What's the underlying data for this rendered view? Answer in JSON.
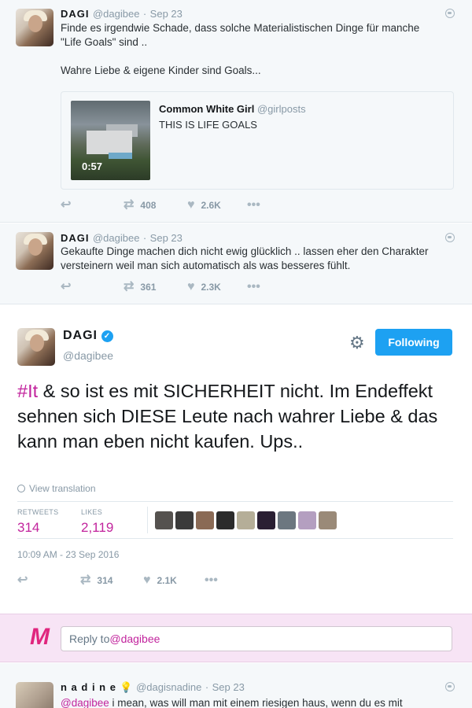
{
  "tweets_above": [
    {
      "name": "DAGI",
      "handle": "@dagibee",
      "date": "Sep 23",
      "text_lines": [
        "Finde es irgendwie Schade, dass solche Materialistischen Dinge für manche",
        "\"Life Goals\" sind ..",
        "",
        "Wahre Liebe & eigene Kinder sind Goals..."
      ],
      "quoted": {
        "name": "Common White Girl",
        "handle": "@girlposts",
        "text": "THIS IS LIFE GOALS",
        "video_duration": "0:57"
      },
      "retweets": "408",
      "likes": "2.6K"
    },
    {
      "name": "DAGI",
      "handle": "@dagibee",
      "date": "Sep 23",
      "text_lines": [
        "Gekaufte Dinge machen dich nicht ewig glücklich .. lassen eher den Charakter",
        "versteinern weil man sich automatisch als was besseres fühlt."
      ],
      "retweets": "361",
      "likes": "2.3K"
    }
  ],
  "main_tweet": {
    "name": "DAGI",
    "handle": "@dagibee",
    "follow_label": "Following",
    "hashtag": "#It",
    "text_rest": " & so ist es mit SICHERHEIT nicht. Im Endeffekt sehnen sich DIESE Leute nach wahrer Liebe & das kann man eben nicht kaufen. Ups..",
    "translate_label": "View translation",
    "retweets_label": "RETWEETS",
    "retweets_value": "314",
    "likes_label": "LIKES",
    "likes_value": "2,119",
    "liker_colors": [
      "#55524f",
      "#3a3a3a",
      "#8a6a55",
      "#2b2b2b",
      "#b5ae98",
      "#2a1f33",
      "#6c7780",
      "#b49fc0",
      "#9a8a78"
    ],
    "timestamp": "10:09 AM - 23 Sep 2016",
    "action_retweets": "314",
    "action_likes": "2.1K"
  },
  "reply": {
    "logo": "M",
    "prefix": "Reply to ",
    "mention": "@dagibee"
  },
  "tweet_below": {
    "name": "n a d i n e",
    "handle": "@dagisnadine",
    "date": "Sep 23",
    "mention": "@dagibee",
    "text": " i mean, was will man mit einem riesigen haus, wenn du es mit"
  },
  "icons": {
    "reply": "reply-icon",
    "retweet": "retweet-icon",
    "like": "heart-icon",
    "more": "more-icon",
    "globe": "globe-icon",
    "gear": "gear-icon",
    "verified": "verified-badge-icon",
    "bulb": "lightbulb-emoji-icon"
  },
  "colors": {
    "accent": "#1da1f2",
    "brand_pink": "#c2249d",
    "reply_bar_bg": "#f7e4f5"
  }
}
